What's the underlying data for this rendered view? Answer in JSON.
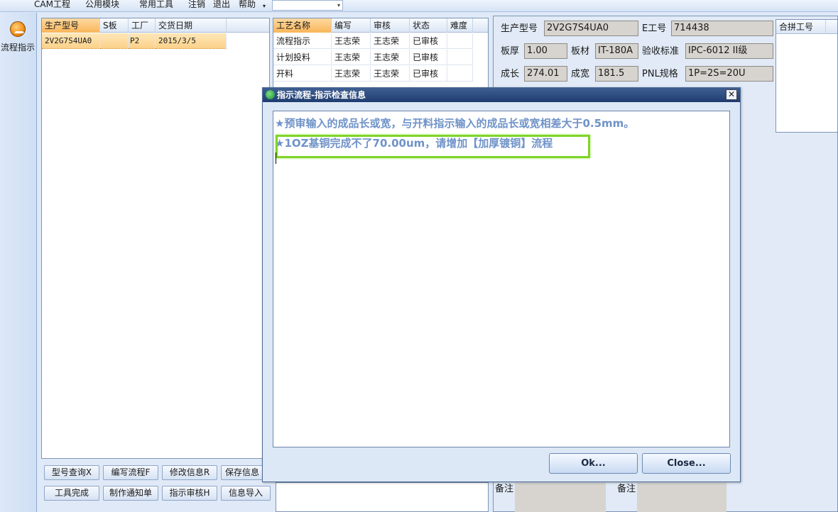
{
  "menubar": {
    "items": [
      "CAM工程",
      "公用模块",
      "常用工具",
      "注销",
      "退出",
      "帮助"
    ],
    "dropdown_arrow": "▾",
    "combo_value": ""
  },
  "leftnav": {
    "button_label": "流程指示",
    "icon": "process-icon"
  },
  "model_grid": {
    "headers": [
      "生产型号",
      "S板",
      "工厂",
      "交货日期"
    ],
    "rows": [
      {
        "model": "2V2G7S4UA0",
        "s_board": "",
        "factory": "P2",
        "delivery": "2015/3/5"
      }
    ]
  },
  "process_grid": {
    "headers": [
      "工艺名称",
      "编写",
      "审核",
      "状态",
      "难度"
    ],
    "rows": [
      {
        "name": "流程指示",
        "writer": "王志荣",
        "reviewer": "王志荣",
        "status": "已审核",
        "difficulty": ""
      },
      {
        "name": "计划投料",
        "writer": "王志荣",
        "reviewer": "王志荣",
        "status": "已审核",
        "difficulty": ""
      },
      {
        "name": "开料",
        "writer": "王志荣",
        "reviewer": "王志荣",
        "status": "已审核",
        "difficulty": ""
      }
    ]
  },
  "buttons": {
    "row1": [
      "型号查询X",
      "编写流程F",
      "修改信息R",
      "保存信息"
    ],
    "row2": [
      "工具完成",
      "制作通知单",
      "指示审核H",
      "信息导入"
    ]
  },
  "info": {
    "model_label": "生产型号",
    "model_value": "2V2G7S4UA0",
    "eno_label": "E工号",
    "eno_value": "714438",
    "thickness_label": "板厚",
    "thickness_value": "1.00",
    "material_label": "板材",
    "material_value": "IT-180A",
    "standard_label": "验收标准",
    "standard_value": "IPC-6012 II级",
    "length_label": "成长",
    "length_value": "274.01",
    "width_label": "成宽",
    "width_value": "181.5",
    "pnl_label": "PNL规格",
    "pnl_value": "1P=2S=20U",
    "merge_header": "合拼工号",
    "note_label_1": "备注",
    "note_label_2": "备注"
  },
  "dialog": {
    "title": "指示流程-指示检查信息",
    "close_glyph": "✕",
    "messages": [
      "★预审输入的成品长或宽，与开料指示输入的成品长或宽相差大于0.5mm。",
      "★1OZ基铜完成不了70.00um，请增加【加厚镀铜】流程"
    ],
    "ok_label": "Ok...",
    "close_label": "Close..."
  },
  "colors": {
    "highlight_border": "#7fd42a",
    "message_text": "#6f93c8",
    "title_bar": "#1f3c6f"
  }
}
